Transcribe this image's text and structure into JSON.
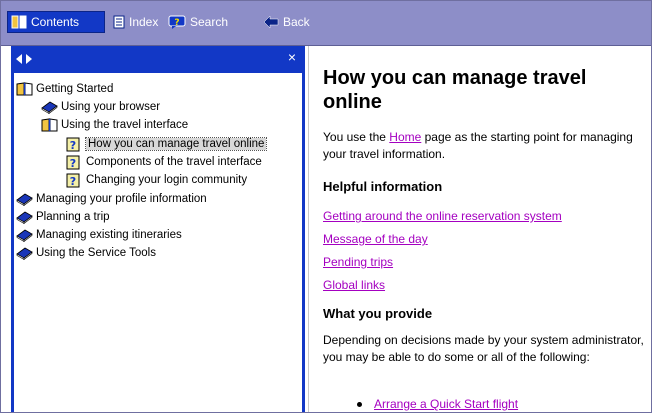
{
  "toolbar": {
    "contents_label": "Contents",
    "index_label": "Index",
    "search_label": "Search",
    "back_label": "Back"
  },
  "tree": {
    "items": [
      {
        "label": "Getting Started",
        "icon": "open-book-icon"
      },
      {
        "label": "Using your browser",
        "icon": "closed-book-icon"
      },
      {
        "label": "Using the travel interface",
        "icon": "open-book-icon"
      },
      {
        "label": "How you can manage travel online",
        "icon": "help-page-icon",
        "selected": true
      },
      {
        "label": "Components of the travel interface",
        "icon": "help-page-icon"
      },
      {
        "label": "Changing your login community",
        "icon": "help-page-icon"
      },
      {
        "label": "Managing your profile information",
        "icon": "closed-book-icon"
      },
      {
        "label": "Planning a trip",
        "icon": "closed-book-icon"
      },
      {
        "label": "Managing existing itineraries",
        "icon": "closed-book-icon"
      },
      {
        "label": "Using the Service Tools",
        "icon": "closed-book-icon"
      }
    ]
  },
  "content": {
    "title": "How you can manage travel online",
    "intro_before": "You use the ",
    "intro_link": "Home",
    "intro_after": " page as the starting point for managing your travel information.",
    "helpful_heading": "Helpful information",
    "helpful_links": [
      "Getting around the online reservation system",
      "Message of the day",
      "Pending trips",
      "Global links"
    ],
    "provide_heading": "What you provide",
    "provide_text": "Depending on decisions made by your system administrator, you may be able to do some or all of the following:",
    "bullets": [
      "Arrange a Quick Start flight"
    ]
  },
  "colors": {
    "toolbar_bg": "#8d8ec8",
    "active_blue": "#1238c6",
    "link_color": "#a400c0"
  }
}
